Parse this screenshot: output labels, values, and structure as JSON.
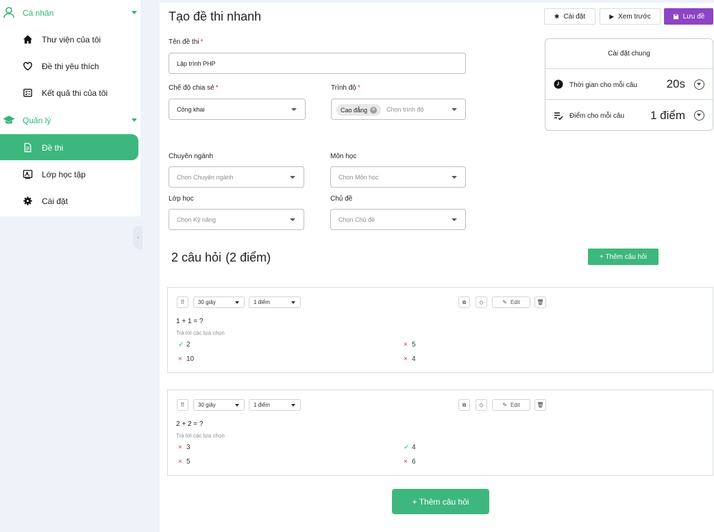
{
  "sidebar": {
    "groups": [
      {
        "label": "Cá nhân",
        "icon": "user-icon"
      },
      {
        "label": "Quản lý",
        "icon": "graduation-cap-icon"
      }
    ],
    "items": [
      {
        "label": "Thư viện của tôi",
        "icon": "home-icon"
      },
      {
        "label": "Đề thi yêu thích",
        "icon": "heart-icon"
      },
      {
        "label": "Kết quả thi của tôi",
        "icon": "result-icon"
      },
      {
        "label": "Đề thi",
        "icon": "document-icon",
        "active": true
      },
      {
        "label": "Lớp học tập",
        "icon": "classroom-icon"
      },
      {
        "label": "Cài đặt",
        "icon": "gear-icon"
      }
    ]
  },
  "header": {
    "title": "Tạo đề thi nhanh",
    "settings_label": "Cài đặt",
    "preview_label": "Xem trước",
    "save_label": "Lưu đề"
  },
  "form": {
    "exam_name_label": "Tên đề thi",
    "exam_name_value": "Lập trình PHP",
    "share_mode_label": "Chế độ chia sẻ",
    "share_mode_value": "Công khai",
    "level_label": "Trình độ",
    "level_tag": "Cao đẳng",
    "level_placeholder": "Chọn trình độ",
    "major_label": "Chuyên ngành",
    "major_placeholder": "Chọn Chuyên ngành",
    "subject_label": "Môn học",
    "subject_placeholder": "Chọn Môn học",
    "class_label": "Lớp học",
    "class_placeholder": "Chọn Kỹ năng",
    "topic_label": "Chủ đề",
    "topic_placeholder": "Chọn Chủ đề",
    "required_mark": "*"
  },
  "general_settings": {
    "title": "Cài đặt chung",
    "time_label": "Thời gian cho mỗi câu",
    "time_value": "20s",
    "score_label": "Điểm cho mỗi câu",
    "score_value": "1 điểm"
  },
  "questions_summary": {
    "count_text": "2 câu hỏi",
    "points_text": "(2 điểm)",
    "add_button": "+ Thêm câu hỏi"
  },
  "questions": [
    {
      "time": "30 giây",
      "score": "1 điểm",
      "edit_label": "Edit",
      "text": "1 + 1 = ?",
      "hint": "Trả lời các lựa chọn",
      "options": [
        {
          "text": "2",
          "correct": true
        },
        {
          "text": "5",
          "correct": false
        },
        {
          "text": "10",
          "correct": false
        },
        {
          "text": "4",
          "correct": false
        }
      ]
    },
    {
      "time": "30 giây",
      "score": "1 điểm",
      "edit_label": "Edit",
      "text": "2 + 2 = ?",
      "hint": "Trả lời các lựa chọn",
      "options": [
        {
          "text": "3",
          "correct": false
        },
        {
          "text": "4",
          "correct": true
        },
        {
          "text": "5",
          "correct": false
        },
        {
          "text": "6",
          "correct": false
        }
      ]
    }
  ],
  "footer": {
    "add_button": "+ Thêm câu hỏi"
  },
  "marks": {
    "correct": "✓",
    "wrong": "×"
  },
  "colors": {
    "accent": "#3db77e",
    "primary_button": "#8e44c4",
    "required": "#e0324b"
  }
}
